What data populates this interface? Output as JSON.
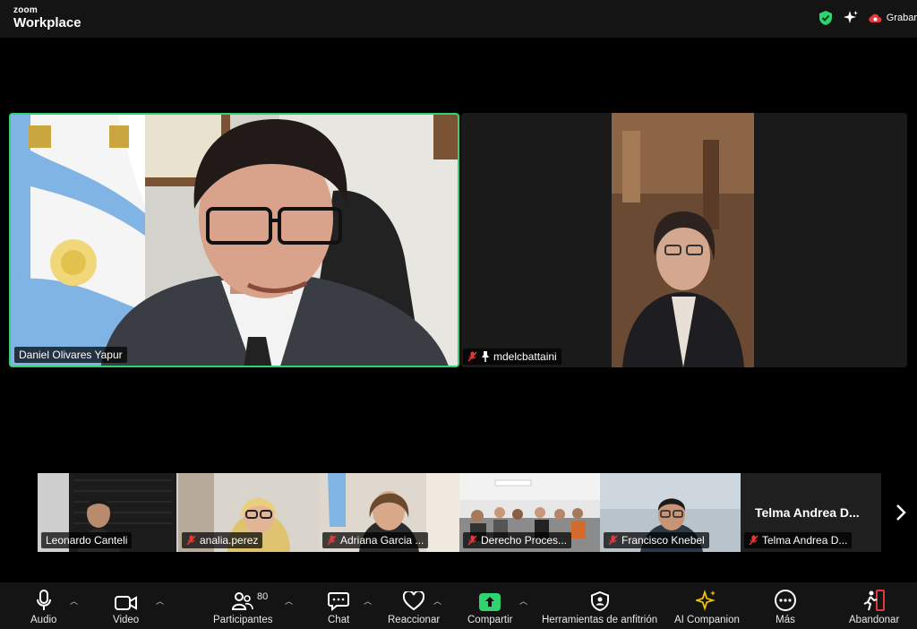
{
  "app": {
    "logo_small": "zoom",
    "logo_big": "Workplace"
  },
  "topbar": {
    "record_label": "Grabar"
  },
  "colors": {
    "active_speaker_border": "#2fd36f",
    "share_green": "#2fd36f",
    "mic_off_red": "#e23a3a",
    "ai_companion_gold": "#f2c200"
  },
  "main_tiles": [
    {
      "name": "Daniel Olivares Yapur",
      "muted": false,
      "pinned": false,
      "active_speaker": true
    },
    {
      "name": "mdelcbattaini",
      "muted": true,
      "pinned": true,
      "active_speaker": false
    }
  ],
  "thumbnails": [
    {
      "name": "Leonardo Canteli",
      "muted": false
    },
    {
      "name": "analia.perez",
      "muted": true
    },
    {
      "name": "Adriana Garcia ...",
      "muted": true
    },
    {
      "name": "Derecho Proces...",
      "muted": true
    },
    {
      "name": "Francisco Knebel",
      "muted": true
    },
    {
      "name": "Telma Andrea D...",
      "muted": true,
      "video_off": true,
      "display_text": "Telma Andrea D..."
    }
  ],
  "toolbar": {
    "audio": "Audio",
    "video": "Video",
    "participants": "Participantes",
    "participants_count": "80",
    "chat": "Chat",
    "react": "Reaccionar",
    "share": "Compartir",
    "host_tools": "Herramientas de anfitrión",
    "ai_companion": "AI Companion",
    "more": "Más",
    "leave": "Abandonar"
  },
  "icons": [
    "shield-check-icon",
    "sparkle-icon",
    "cloud-record-icon",
    "microphone-icon",
    "video-camera-icon",
    "participants-icon",
    "chat-icon",
    "heart-icon",
    "share-screen-icon",
    "host-shield-icon",
    "ai-sparkle-icon",
    "more-icon",
    "leave-icon",
    "chevron-up-icon",
    "chevron-right-icon",
    "mic-off-icon",
    "pin-icon"
  ]
}
